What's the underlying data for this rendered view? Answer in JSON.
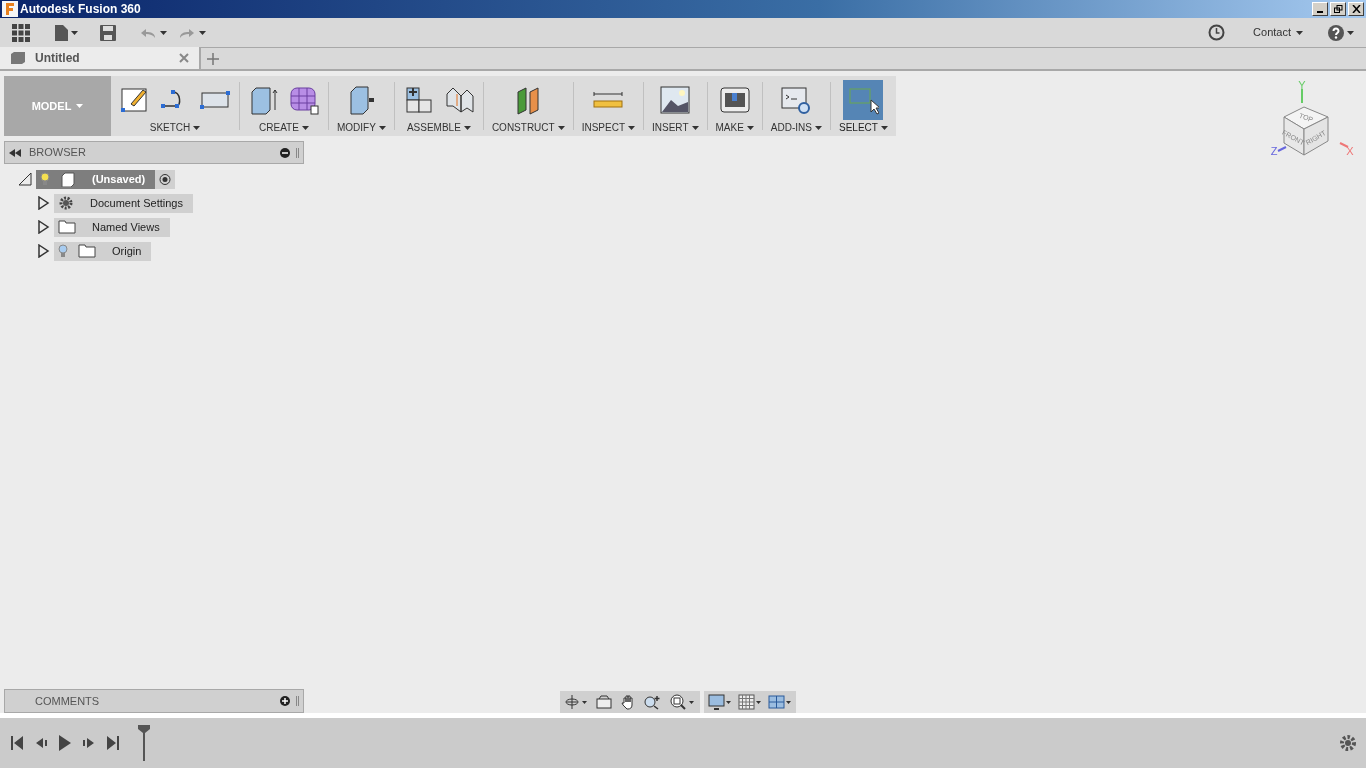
{
  "window": {
    "title": "Autodesk Fusion 360"
  },
  "top_bar": {
    "contact": "Contact"
  },
  "tabs": [
    {
      "label": "Untitled",
      "selected": true
    }
  ],
  "workspace": "MODEL",
  "ribbon": [
    {
      "label": "SKETCH",
      "selected": false
    },
    {
      "label": "CREATE",
      "selected": false
    },
    {
      "label": "MODIFY",
      "selected": false
    },
    {
      "label": "ASSEMBLE",
      "selected": false
    },
    {
      "label": "CONSTRUCT",
      "selected": false
    },
    {
      "label": "INSPECT",
      "selected": false
    },
    {
      "label": "INSERT",
      "selected": false
    },
    {
      "label": "MAKE",
      "selected": false
    },
    {
      "label": "ADD-INS",
      "selected": false
    },
    {
      "label": "SELECT",
      "selected": true
    }
  ],
  "browser": {
    "title": "BROWSER",
    "tree": [
      {
        "label": "(Unsaved)",
        "kind": "component",
        "visible": true,
        "expanded": true,
        "selected": true,
        "children": [
          {
            "label": "Document Settings",
            "kind": "settings",
            "visible": false,
            "expanded": false,
            "selected": false
          },
          {
            "label": "Named Views",
            "kind": "folder",
            "visible": false,
            "expanded": false,
            "selected": false
          },
          {
            "label": "Origin",
            "kind": "folder",
            "visible": true,
            "expanded": false,
            "selected": false
          }
        ]
      }
    ]
  },
  "view_cube": {
    "faces": [
      "TOP",
      "FRONT",
      "RIGHT"
    ],
    "axes": [
      "Y",
      "Z",
      "X"
    ]
  },
  "comments": {
    "title": "COMMENTS"
  }
}
